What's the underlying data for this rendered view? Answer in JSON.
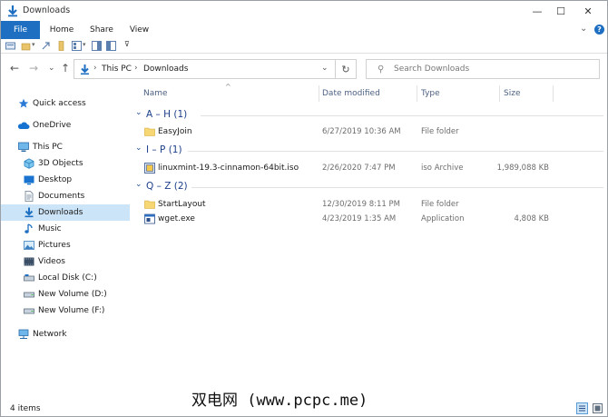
{
  "window": {
    "title": "Downloads",
    "controls": {
      "minimize": "—",
      "maximize": "☐",
      "close": "✕"
    }
  },
  "ribbon": {
    "tabs": [
      "File",
      "Home",
      "Share",
      "View"
    ],
    "expand_glyph": "⌄",
    "help_glyph": "?",
    "accent": "#1e6fc1"
  },
  "navbar": {
    "back": "←",
    "forward": "→",
    "recent": "⌄",
    "up": "↑",
    "breadcrumb": [
      "This PC",
      "Downloads"
    ],
    "crumb_sep": "›",
    "dropdown": "⌄",
    "refresh": "↻",
    "search_icon": "⚲",
    "search_placeholder": "Search Downloads"
  },
  "sidebar": {
    "items": [
      {
        "label": "Quick access",
        "icon": "star-icon"
      },
      {
        "label": "OneDrive",
        "icon": "cloud-icon"
      },
      {
        "label": "This PC",
        "icon": "computer-icon"
      },
      {
        "label": "3D Objects",
        "icon": "cube-icon"
      },
      {
        "label": "Desktop",
        "icon": "desktop-icon"
      },
      {
        "label": "Documents",
        "icon": "document-icon"
      },
      {
        "label": "Downloads",
        "icon": "download-icon",
        "selected": true
      },
      {
        "label": "Music",
        "icon": "music-icon"
      },
      {
        "label": "Pictures",
        "icon": "picture-icon"
      },
      {
        "label": "Videos",
        "icon": "video-icon"
      },
      {
        "label": "Local Disk (C:)",
        "icon": "drive-icon"
      },
      {
        "label": "New Volume (D:)",
        "icon": "drive-icon"
      },
      {
        "label": "New Volume (F:)",
        "icon": "drive-icon"
      },
      {
        "label": "Network",
        "icon": "network-icon"
      }
    ]
  },
  "columns": {
    "name": "Name",
    "date": "Date modified",
    "type": "Type",
    "size": "Size",
    "sort_glyph": "^"
  },
  "groups": [
    {
      "label": "A – H (1)",
      "chevron": "⌄",
      "rows": [
        {
          "name": "EasyJoin",
          "date": "6/27/2019 10:36 AM",
          "type": "File folder",
          "size": "",
          "icon": "folder-icon"
        }
      ]
    },
    {
      "label": "I – P (1)",
      "chevron": "⌄",
      "rows": [
        {
          "name": "linuxmint-19.3-cinnamon-64bit.iso",
          "date": "2/26/2020 7:47 PM",
          "type": "iso Archive",
          "size": "1,989,088 KB",
          "icon": "archive-icon"
        }
      ]
    },
    {
      "label": "Q – Z (2)",
      "chevron": "⌄",
      "rows": [
        {
          "name": "StartLayout",
          "date": "12/30/2019 8:11 PM",
          "type": "File folder",
          "size": "",
          "icon": "folder-icon"
        },
        {
          "name": "wget.exe",
          "date": "4/23/2019 1:35 AM",
          "type": "Application",
          "size": "4,808 KB",
          "icon": "application-icon"
        }
      ]
    }
  ],
  "status": {
    "items": "4 items"
  },
  "watermark": "双电网 (www.pcpc.me)"
}
